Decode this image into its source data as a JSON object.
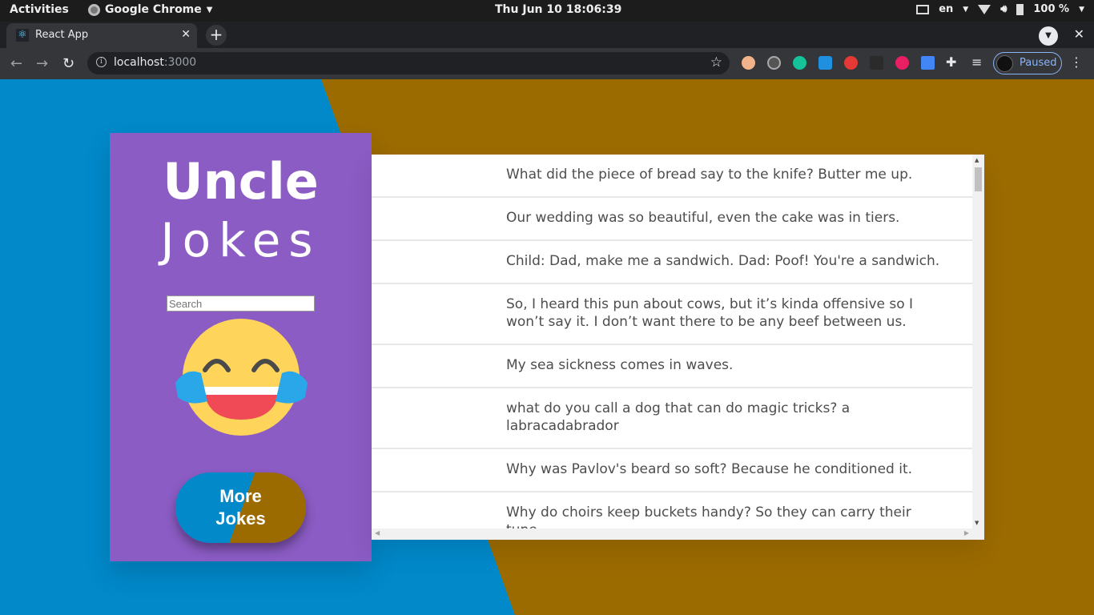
{
  "topbar": {
    "activities": "Activities",
    "app_name": "Google Chrome",
    "clock": "Thu Jun 10  18:06:39",
    "lang": "en",
    "battery": "100 %"
  },
  "browser": {
    "tab_title": "React App",
    "url_host": "localhost",
    "url_port": ":3000",
    "profile_status": "Paused"
  },
  "app": {
    "title_line1": "Uncle",
    "title_line2": "Jokes",
    "search_placeholder": "Search",
    "more_button": "More Jokes",
    "jokes": [
      "What did the piece of bread say to the knife? Butter me up.",
      "Our wedding was so beautiful, even the cake was in tiers.",
      "Child: Dad, make me a sandwich. Dad: Poof! You're a sandwich.",
      "So, I heard this pun about cows, but it’s kinda offensive so I won’t say it. I don’t want there to be any beef between us.",
      "My sea sickness comes in waves.",
      "what do you call a dog that can do magic tricks? a labracadabrador",
      "Why was Pavlov's beard so soft? Because he conditioned it.",
      "Why do choirs keep buckets handy? So they can carry their tune"
    ]
  },
  "colors": {
    "page_blue": "#0189ca",
    "page_bronze": "#9c6b00",
    "sidebar_purple": "#8b5cc4"
  }
}
